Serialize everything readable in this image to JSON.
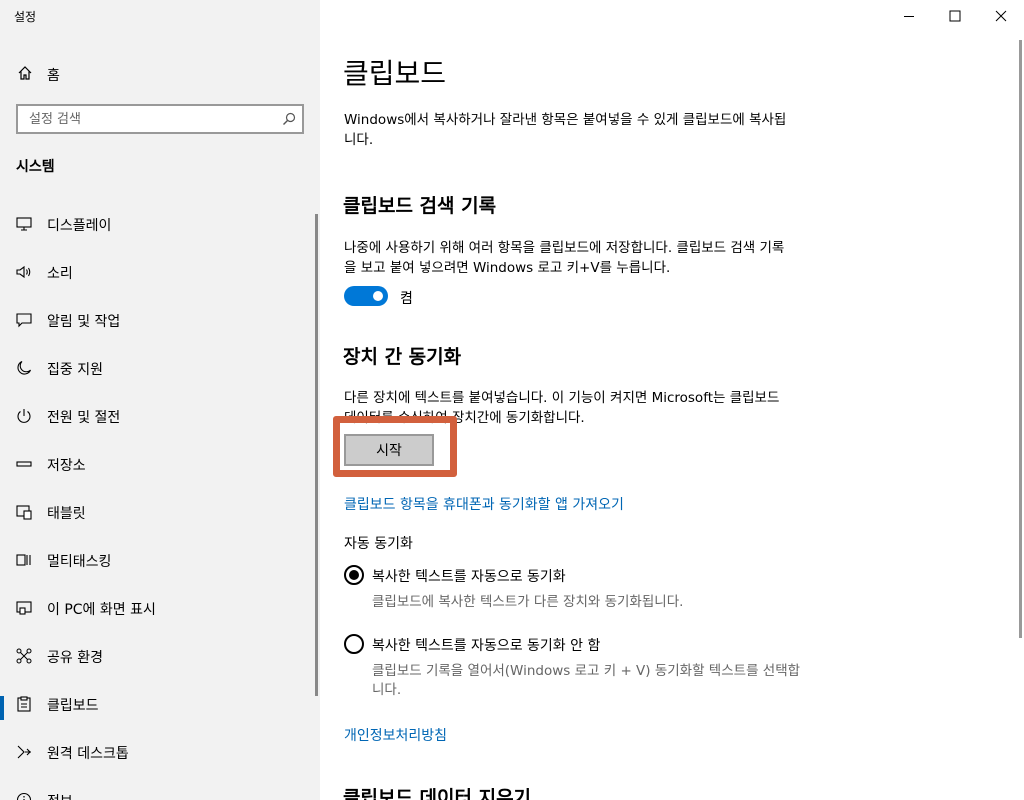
{
  "app": {
    "title": "설정"
  },
  "sidebar": {
    "home_label": "홈",
    "search_placeholder": "설정 검색",
    "section_title": "시스템",
    "items": [
      {
        "label": "디스플레이",
        "icon": "monitor-icon"
      },
      {
        "label": "소리",
        "icon": "speaker-icon"
      },
      {
        "label": "알림 및 작업",
        "icon": "notification-icon"
      },
      {
        "label": "집중 지원",
        "icon": "moon-icon"
      },
      {
        "label": "전원 및 절전",
        "icon": "power-icon"
      },
      {
        "label": "저장소",
        "icon": "storage-icon"
      },
      {
        "label": "태블릿",
        "icon": "tablet-icon"
      },
      {
        "label": "멀티태스킹",
        "icon": "multitasking-icon"
      },
      {
        "label": "이 PC에 화면 표시",
        "icon": "project-icon"
      },
      {
        "label": "공유 환경",
        "icon": "share-icon"
      },
      {
        "label": "클립보드",
        "icon": "clipboard-icon",
        "selected": true
      },
      {
        "label": "원격 데스크톱",
        "icon": "remote-icon"
      },
      {
        "label": "정보",
        "icon": "info-icon"
      }
    ]
  },
  "main": {
    "title": "클립보드",
    "intro": "Windows에서 복사하거나 잘라낸 항목은 붙여넣을 수 있게 클립보드에 복사됩니다.",
    "history": {
      "heading": "클립보드 검색 기록",
      "desc": "나중에 사용하기 위해 여러 항목을 클립보드에 저장합니다. 클립보드 검색 기록을 보고 붙여 넣으려면 Windows 로고 키+V를 누릅니다.",
      "toggle_state": "켬"
    },
    "sync": {
      "heading": "장치 간 동기화",
      "desc": "다른 장치에 텍스트를 붙여넣습니다. 이 기능이 켜지면 Microsoft는 클립보드 데이터를 수신하여 장치간에 동기화합니다.",
      "start_button": "시작",
      "phone_link": "클립보드 항목을 휴대폰과 동기화할 앱 가져오기",
      "auto_sync_label": "자동 동기화",
      "option1_label": "복사한 텍스트를 자동으로 동기화",
      "option1_desc": "클립보드에 복사한 텍스트가 다른 장치와 동기화됩니다.",
      "option2_label": "복사한 텍스트를 자동으로 동기화 안 함",
      "option2_desc": "클립보드 기록을 열어서(Windows 로고 키 + V) 동기화할 텍스트를 선택합니다.",
      "privacy_link": "개인정보처리방침"
    },
    "clear": {
      "heading": "클립보드 데이터 지우기"
    }
  },
  "colors": {
    "accent": "#0078d7",
    "link": "#0066b4",
    "highlight": "#d2603d"
  }
}
